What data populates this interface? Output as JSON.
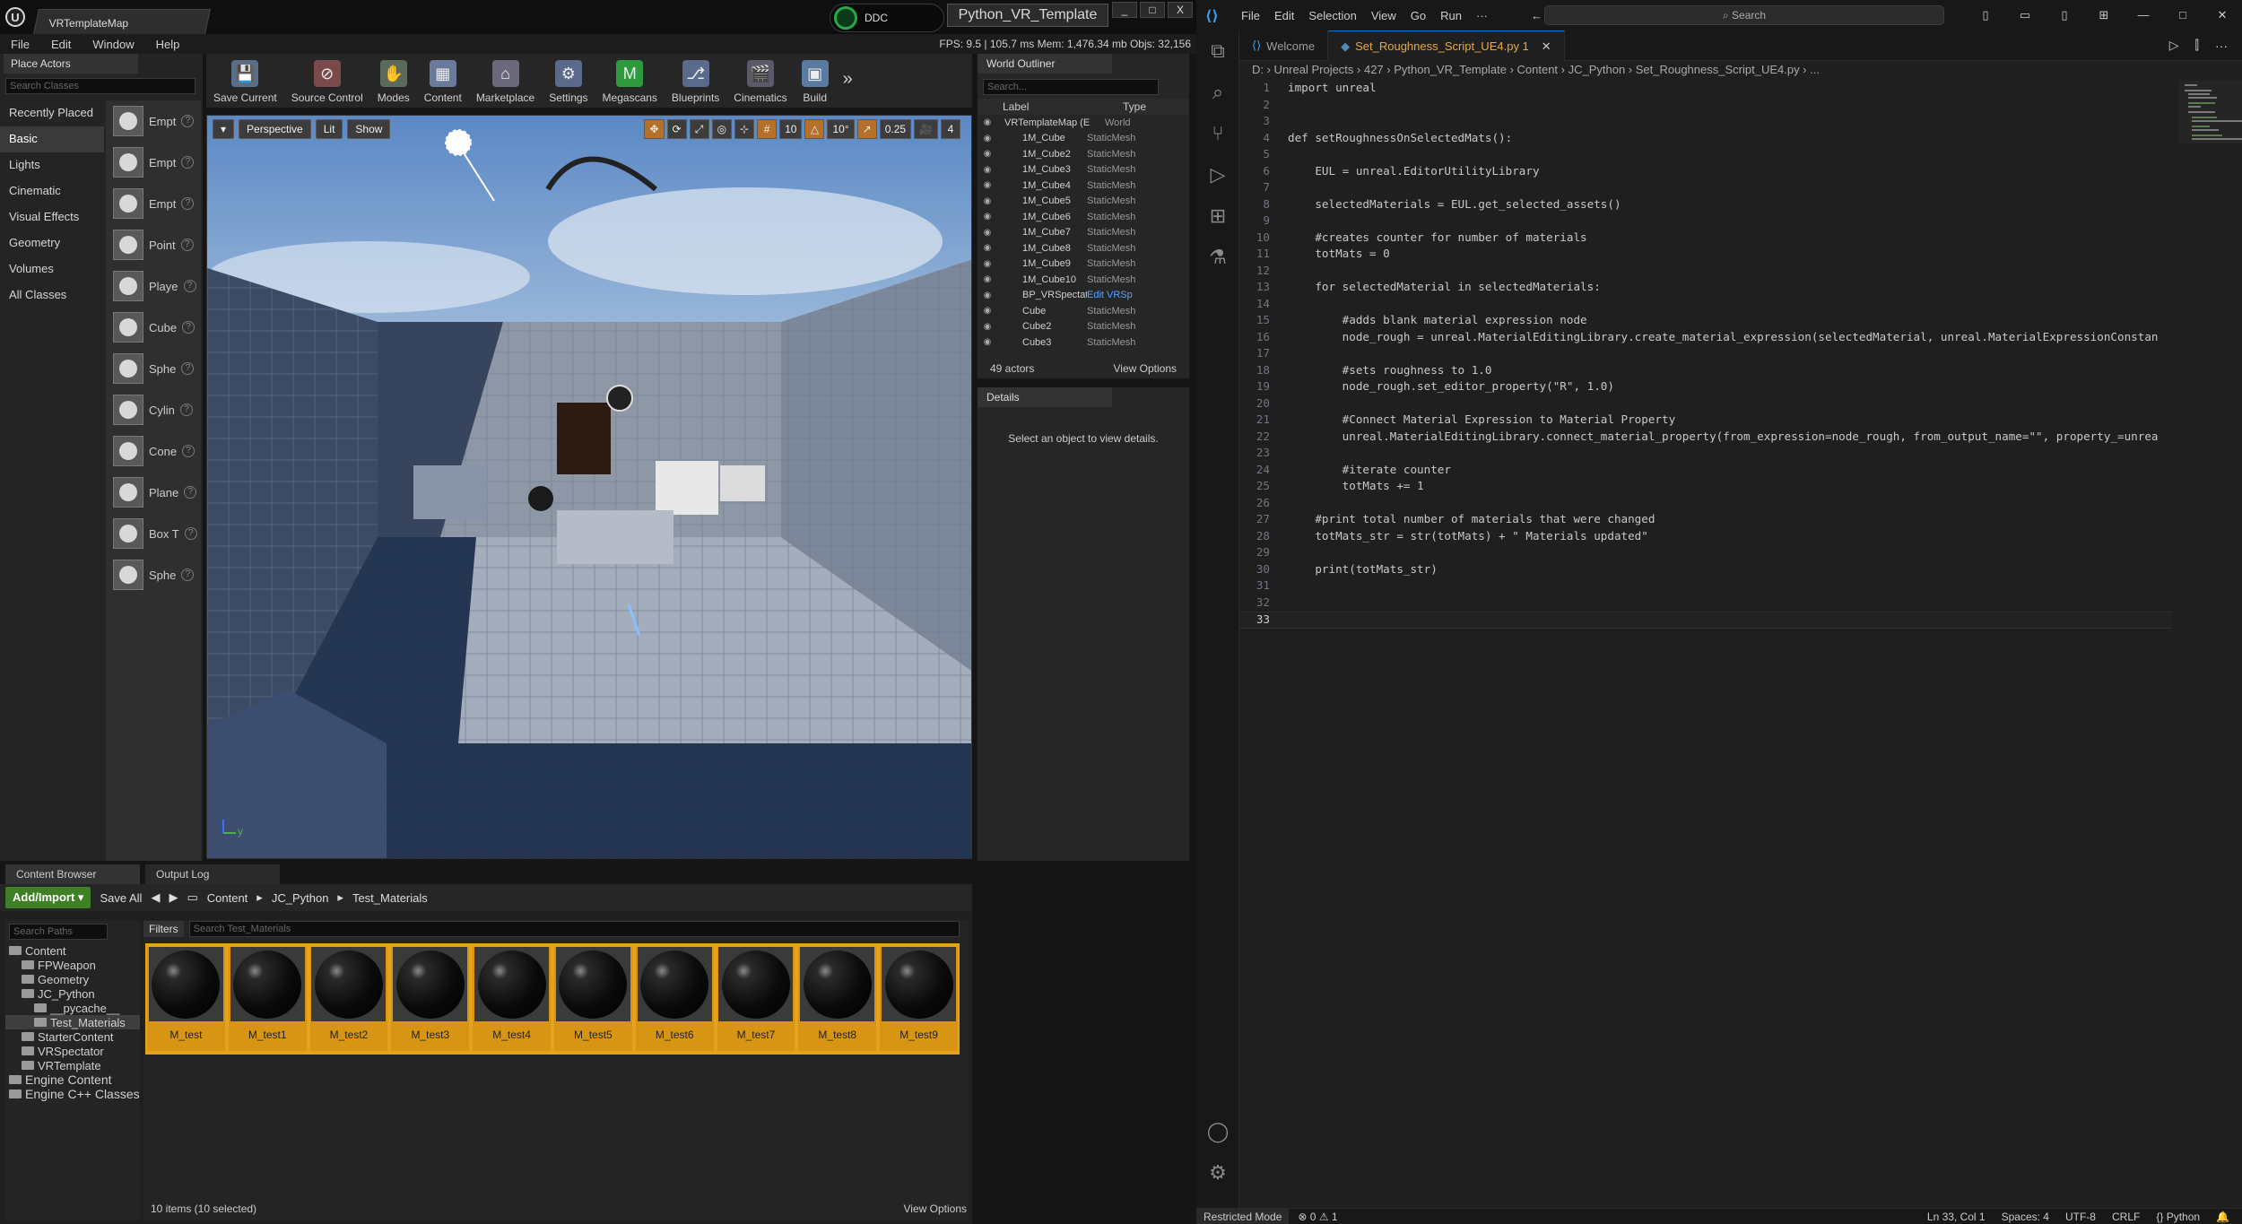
{
  "ue": {
    "map_tab": "VRTemplateMap",
    "ddc": "DDC",
    "project": "Python_VR_Template",
    "win_buttons": [
      "_",
      "□",
      "X"
    ],
    "menu": [
      "File",
      "Edit",
      "Window",
      "Help"
    ],
    "stats": "FPS: 9.5  |  105.7 ms  Mem: 1,476.34 mb  Objs: 32,156",
    "place_actors": {
      "tab": "Place Actors",
      "search_placeholder": "Search Classes",
      "categories": [
        "Recently Placed",
        "Basic",
        "Lights",
        "Cinematic",
        "Visual Effects",
        "Geometry",
        "Volumes",
        "All Classes"
      ],
      "items": [
        "Empt",
        "Empt",
        "Empt",
        "Point",
        "Playe",
        "Cube",
        "Sphe",
        "Cylin",
        "Cone",
        "Plane",
        "Box T",
        "Sphe"
      ]
    },
    "toolbar": [
      "Save Current",
      "Source Control",
      "Modes",
      "Content",
      "Marketplace",
      "Settings",
      "Megascans",
      "Blueprints",
      "Cinematics",
      "Build"
    ],
    "viewport": {
      "perspective": "Perspective",
      "lit": "Lit",
      "show": "Show",
      "grid": "10",
      "rot": "10°",
      "scale": "0.25",
      "cam": "4"
    },
    "outliner": {
      "tab": "World Outliner",
      "search": "Search...",
      "col_label": "Label",
      "col_type": "Type",
      "rows": [
        {
          "label": "VRTemplateMap (E",
          "type": "World"
        },
        {
          "label": "1M_Cube",
          "type": "StaticMesh"
        },
        {
          "label": "1M_Cube2",
          "type": "StaticMesh"
        },
        {
          "label": "1M_Cube3",
          "type": "StaticMesh"
        },
        {
          "label": "1M_Cube4",
          "type": "StaticMesh"
        },
        {
          "label": "1M_Cube5",
          "type": "StaticMesh"
        },
        {
          "label": "1M_Cube6",
          "type": "StaticMesh"
        },
        {
          "label": "1M_Cube7",
          "type": "StaticMesh"
        },
        {
          "label": "1M_Cube8",
          "type": "StaticMesh"
        },
        {
          "label": "1M_Cube9",
          "type": "StaticMesh"
        },
        {
          "label": "1M_Cube10",
          "type": "StaticMesh"
        },
        {
          "label": "BP_VRSpectator",
          "type": "Edit VRSp"
        },
        {
          "label": "Cube",
          "type": "StaticMesh"
        },
        {
          "label": "Cube2",
          "type": "StaticMesh"
        },
        {
          "label": "Cube3",
          "type": "StaticMesh"
        }
      ],
      "count": "49 actors",
      "view_options": "View Options"
    },
    "details": {
      "tab": "Details",
      "msg": "Select an object to view details."
    },
    "content_browser": {
      "tab1": "Content Browser",
      "tab2": "Output Log",
      "add": "Add/Import ▾",
      "save": "Save All",
      "path": [
        "Content",
        "JC_Python",
        "Test_Materials"
      ],
      "search_paths": "Search Paths",
      "tree": [
        {
          "label": "Content",
          "indent": 0
        },
        {
          "label": "FPWeapon",
          "indent": 1
        },
        {
          "label": "Geometry",
          "indent": 1
        },
        {
          "label": "JC_Python",
          "indent": 1
        },
        {
          "label": "__pycache__",
          "indent": 2
        },
        {
          "label": "Test_Materials",
          "indent": 2
        },
        {
          "label": "StarterContent",
          "indent": 1
        },
        {
          "label": "VRSpectator",
          "indent": 1
        },
        {
          "label": "VRTemplate",
          "indent": 1
        },
        {
          "label": "Engine Content",
          "indent": 0
        },
        {
          "label": "Engine C++ Classes",
          "indent": 0
        }
      ],
      "filters": "Filters",
      "search_assets": "Search Test_Materials",
      "materials": [
        "M_test",
        "M_test1",
        "M_test2",
        "M_test3",
        "M_test4",
        "M_test5",
        "M_test6",
        "M_test7",
        "M_test8",
        "M_test9"
      ],
      "count": "10 items (10 selected)",
      "view_options": "View Options"
    }
  },
  "vs": {
    "menu": [
      "File",
      "Edit",
      "Selection",
      "View",
      "Go",
      "Run",
      "···"
    ],
    "search": "Search",
    "tabs": [
      {
        "label": "Welcome"
      },
      {
        "label": "Set_Roughness_Script_UE4.py 1"
      }
    ],
    "breadcrumb": "D: › Unreal Projects › 427 › Python_VR_Template › Content › JC_Python › Set_Roughness_Script_UE4.py › ...",
    "code": [
      "import unreal",
      "",
      "",
      "def setRoughnessOnSelectedMats():",
      "",
      "    EUL = unreal.EditorUtilityLibrary",
      "",
      "    selectedMaterials = EUL.get_selected_assets()",
      "",
      "    #creates counter for number of materials",
      "    totMats = 0",
      "",
      "    for selectedMaterial in selectedMaterials:",
      "",
      "        #adds blank material expression node",
      "        node_rough = unreal.MaterialEditingLibrary.create_material_expression(selectedMaterial, unreal.MaterialExpressionConstan",
      "",
      "        #sets roughness to 1.0",
      "        node_rough.set_editor_property(\"R\", 1.0)",
      "",
      "        #Connect Material Expression to Material Property",
      "        unreal.MaterialEditingLibrary.connect_material_property(from_expression=node_rough, from_output_name=\"\", property_=unrea",
      "",
      "        #iterate counter",
      "        totMats += 1",
      "",
      "    #print total number of materials that were changed",
      "    totMats_str = str(totMats) + \" Materials updated\"",
      "",
      "    print(totMats_str)",
      "",
      "",
      ""
    ],
    "status": {
      "mode": "Restricted Mode",
      "problems": "⊗ 0 ⚠ 1",
      "pos": "Ln 33, Col 1",
      "spaces": "Spaces: 4",
      "enc": "UTF-8",
      "eol": "CRLF",
      "lang": "Python"
    }
  }
}
